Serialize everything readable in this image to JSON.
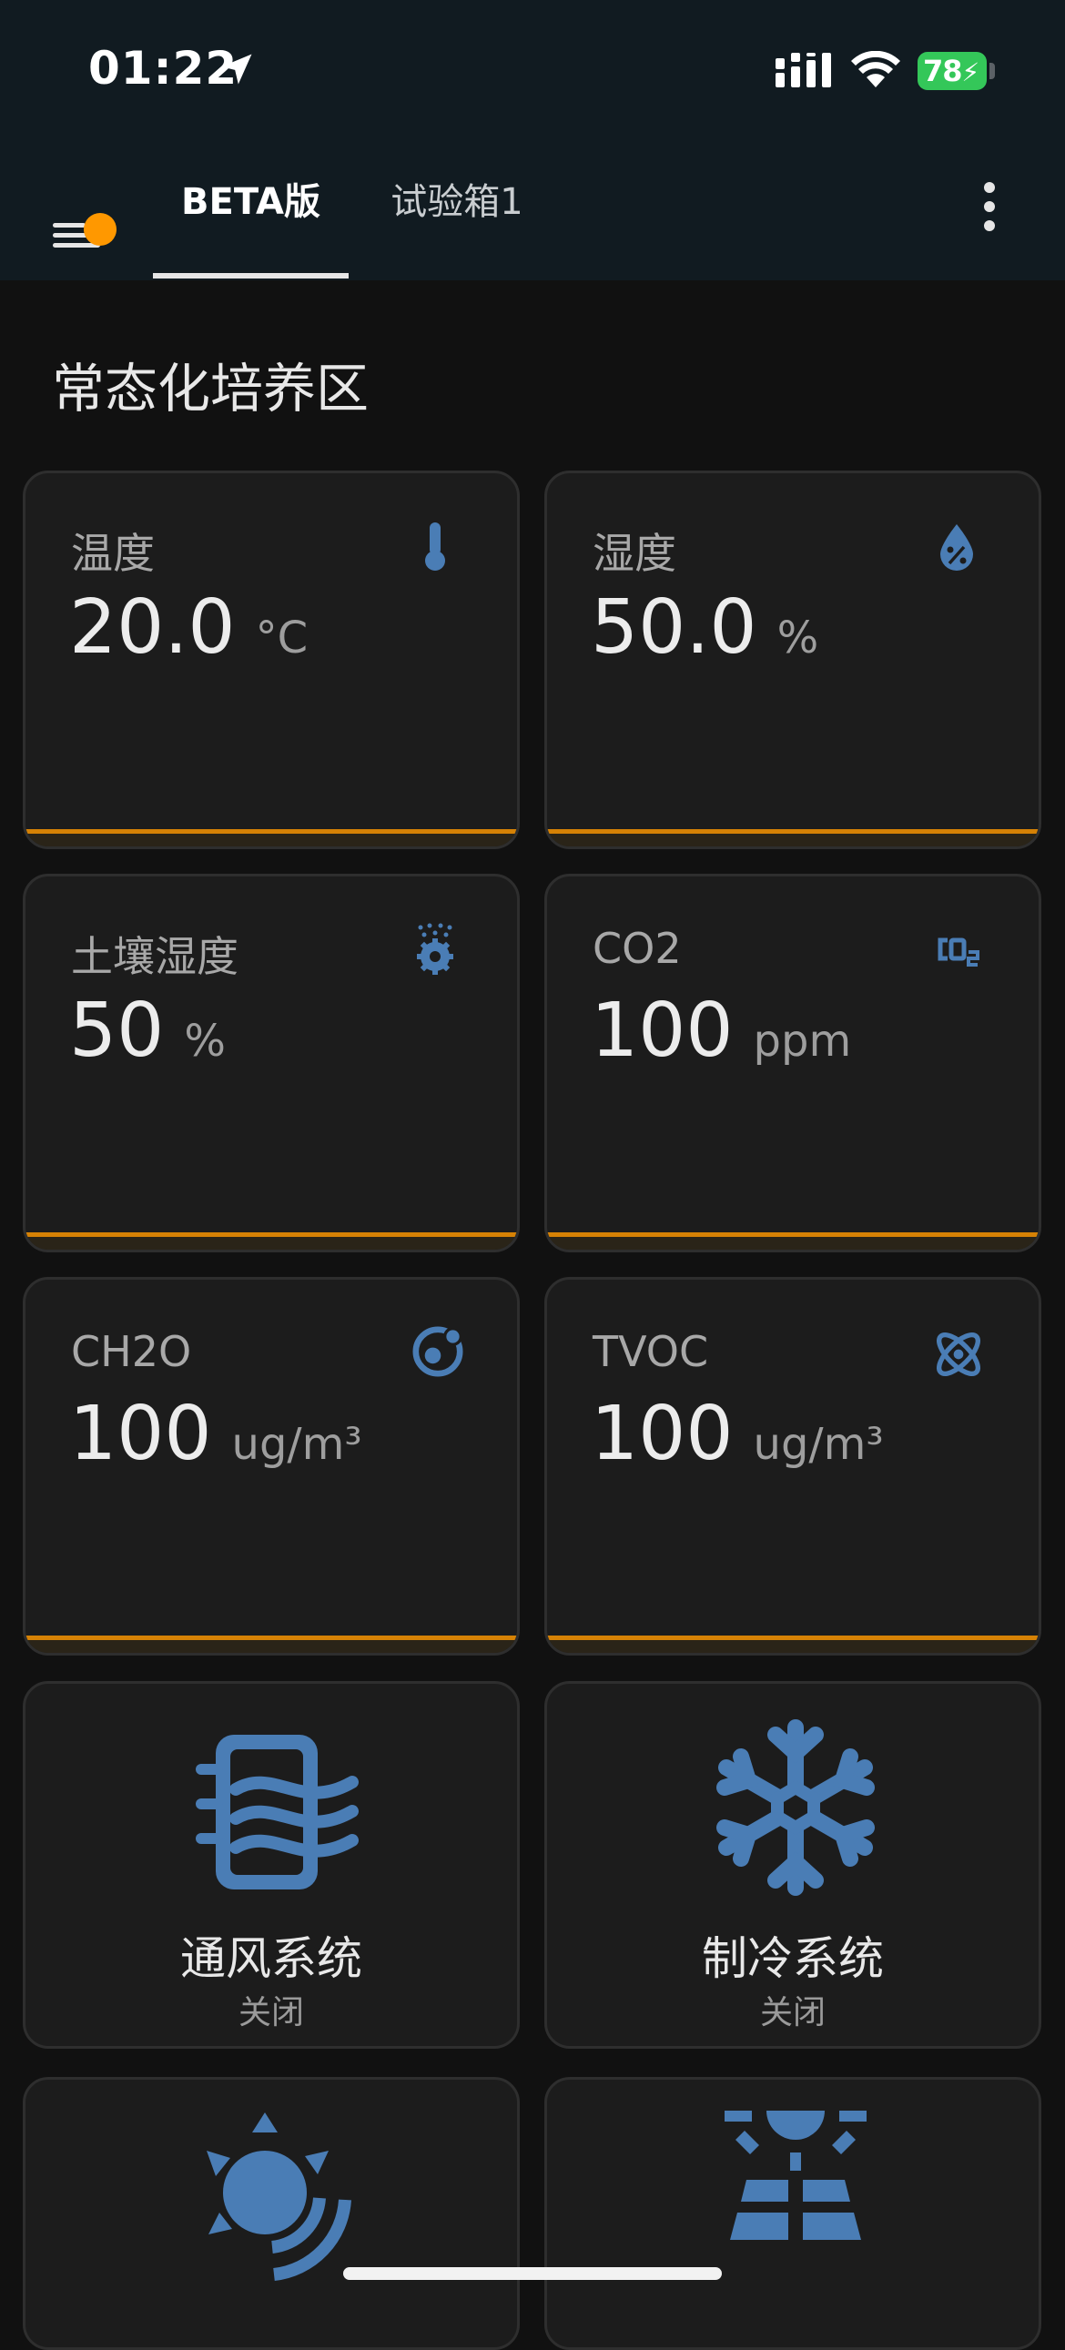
{
  "status_bar": {
    "time": "01:22",
    "battery": "78"
  },
  "app_bar": {
    "tabs": [
      {
        "label": "BETA版",
        "active": true
      },
      {
        "label": "试验箱1",
        "active": false
      }
    ],
    "notification_dot_color": "#ff9800"
  },
  "section": {
    "title": "常态化培养区"
  },
  "sensors": [
    {
      "name": "温度",
      "value": "20.0",
      "unit": "°C",
      "icon": "thermometer-icon"
    },
    {
      "name": "湿度",
      "value": "50.0",
      "unit": "%",
      "icon": "water-percent-icon"
    },
    {
      "name": "土壤湿度",
      "value": "50",
      "unit": "%",
      "icon": "soil-moisture-icon"
    },
    {
      "name": "CO2",
      "value": "100",
      "unit": "ppm",
      "icon": "co2-icon"
    },
    {
      "name": "CH2O",
      "value": "100",
      "unit": "ug/m³",
      "icon": "molecule-icon"
    },
    {
      "name": "TVOC",
      "value": "100",
      "unit": "ug/m³",
      "icon": "atom-icon"
    }
  ],
  "controls": [
    {
      "name": "通风系统",
      "state": "关闭",
      "icon": "ventilation-icon"
    },
    {
      "name": "制冷系统",
      "state": "关闭",
      "icon": "snowflake-icon"
    },
    {
      "name": "",
      "state": "",
      "icon": "sun-wireless-icon"
    },
    {
      "name": "",
      "state": "",
      "icon": "solar-panel-icon"
    }
  ],
  "colors": {
    "accent_bar": "#ff9800",
    "icon_blue": "#4a7db5",
    "card_bg": "#1c1c1c",
    "app_bar_bg": "#111b21"
  }
}
